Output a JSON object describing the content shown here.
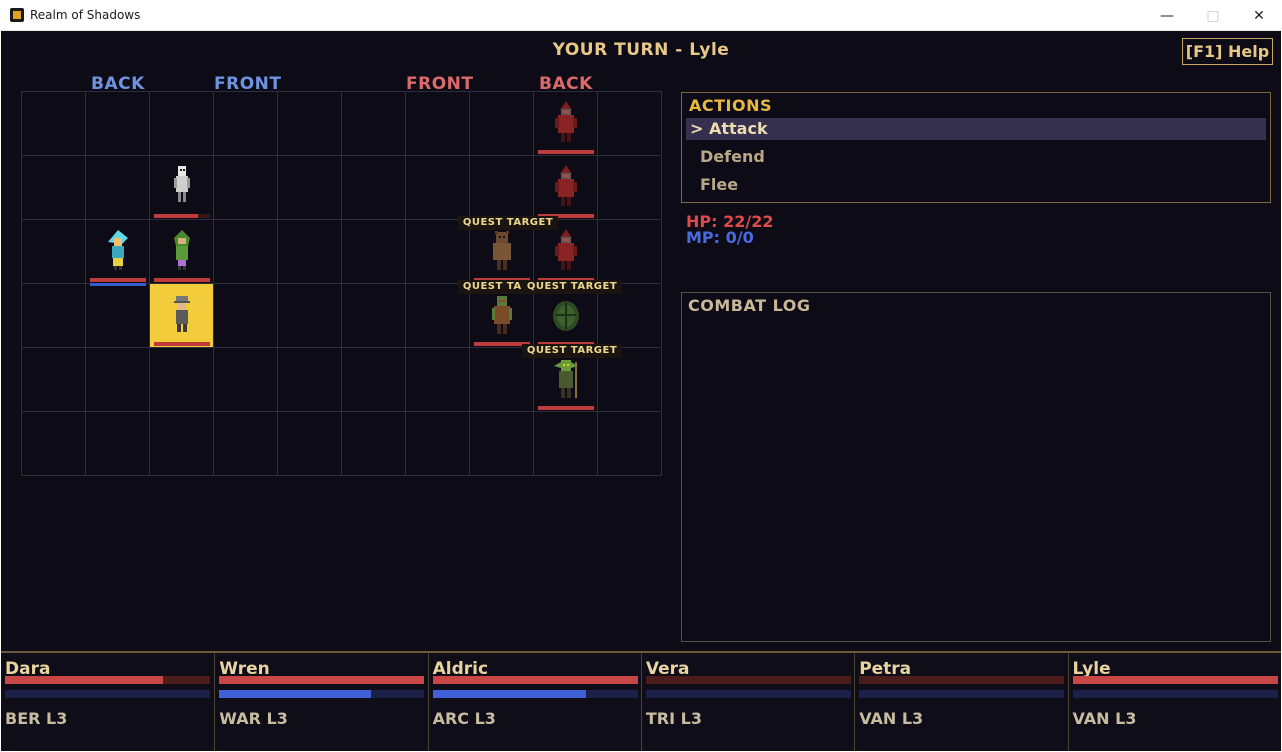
{
  "window": {
    "title": "Realm of Shadows"
  },
  "battle": {
    "turn_banner": "YOUR TURN - Lyle",
    "help_label": "[F1] Help",
    "column_labels": [
      "BACK",
      "FRONT",
      "FRONT",
      "BACK"
    ],
    "quest_tag": "QUEST TARGET"
  },
  "actions": {
    "title": "ACTIONS",
    "items": [
      "> Attack",
      "Defend",
      "Flee"
    ],
    "selected": 0
  },
  "stats": {
    "hp": "HP: 22/22",
    "mp": "MP: 0/0"
  },
  "combat_log": {
    "title": "COMBAT LOG",
    "entries": []
  },
  "party": [
    {
      "name": "Dara",
      "class": "BER L3",
      "hp": 0.77,
      "mp": 0
    },
    {
      "name": "Wren",
      "class": "WAR L3",
      "hp": 1.0,
      "mp": 0.74
    },
    {
      "name": "Aldric",
      "class": "ARC L3",
      "hp": 1.0,
      "mp": 0.75
    },
    {
      "name": "Vera",
      "class": "TRI L3",
      "hp": 0,
      "mp": 0
    },
    {
      "name": "Petra",
      "class": "VAN L3",
      "hp": 0,
      "mp": 0
    },
    {
      "name": "Lyle",
      "class": "VAN L3",
      "hp": 1.0,
      "mp": 0
    }
  ],
  "units": [
    {
      "side": "ally",
      "col": 1,
      "row": 1,
      "sprite": "skull-knight-sprite",
      "hp": 0.78,
      "active": false,
      "quest": false
    },
    {
      "side": "ally",
      "col": 1,
      "row": 2,
      "sprite": "green-hood-sprite",
      "hp": 1.0,
      "active": false,
      "quest": false
    },
    {
      "side": "ally",
      "col": 0,
      "row": 2,
      "sprite": "cyan-mage-sprite",
      "hp": 1.0,
      "mp": 1.0,
      "active": false,
      "quest": false
    },
    {
      "side": "ally",
      "col": 1,
      "row": 3,
      "sprite": "gray-helm-sprite",
      "hp": 1.0,
      "active": true,
      "quest": false
    },
    {
      "side": "enemy",
      "col": 3,
      "row": 0,
      "sprite": "red-cultist-sprite",
      "hp": 1.0,
      "active": false,
      "quest": false
    },
    {
      "side": "enemy",
      "col": 3,
      "row": 1,
      "sprite": "red-cultist-sprite",
      "hp": 1.0,
      "active": false,
      "quest": false
    },
    {
      "side": "enemy",
      "col": 2,
      "row": 2,
      "sprite": "bear-warrior-sprite",
      "hp": 1.0,
      "active": false,
      "quest": true
    },
    {
      "side": "enemy",
      "col": 3,
      "row": 2,
      "sprite": "red-cultist-sprite",
      "hp": 1.0,
      "active": false,
      "quest": false
    },
    {
      "side": "enemy",
      "col": 2,
      "row": 3,
      "sprite": "brown-orc-sprite",
      "hp": 1.0,
      "active": false,
      "quest": true
    },
    {
      "side": "enemy",
      "col": 3,
      "row": 3,
      "sprite": "spiked-plant-sprite",
      "hp": 1.0,
      "active": false,
      "quest": true
    },
    {
      "side": "enemy",
      "col": 3,
      "row": 4,
      "sprite": "goblin-shaman-sprite",
      "hp": 1.0,
      "active": false,
      "quest": true
    }
  ],
  "colors": {
    "accent": "#e8b840",
    "ally_label": "#6f93e0",
    "enemy_label": "#dd6a6a",
    "hp": "#c84646",
    "mp": "#4060d8",
    "active_cell": "#f2cc3a"
  }
}
